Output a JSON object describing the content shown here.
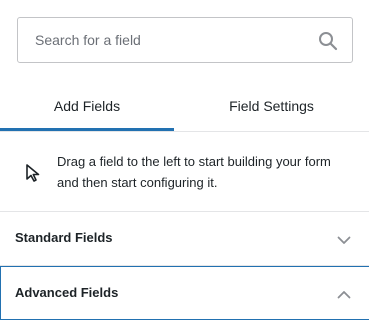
{
  "search": {
    "placeholder": "Search for a field"
  },
  "tabs": [
    {
      "label": "Add Fields",
      "active": true
    },
    {
      "label": "Field Settings",
      "active": false
    }
  ],
  "hint": {
    "text": "Drag a field to the left to start building your form and then start configuring it."
  },
  "sections": [
    {
      "label": "Standard Fields",
      "expanded": false
    },
    {
      "label": "Advanced Fields",
      "expanded": true
    }
  ],
  "colors": {
    "accent": "#2271b1",
    "text": "#1d2327",
    "border": "#c3c4c7",
    "divider": "#e4e5e7",
    "icon": "#8c8f94"
  }
}
